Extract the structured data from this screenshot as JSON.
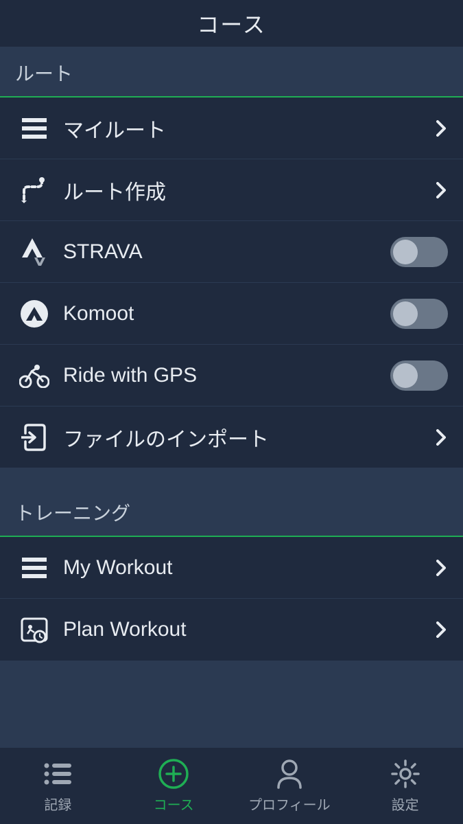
{
  "header": {
    "title": "コース"
  },
  "sections": {
    "routes": {
      "title": "ルート",
      "items": {
        "my_routes": "マイルート",
        "create_route": "ルート作成",
        "strava": "STRAVA",
        "komoot": "Komoot",
        "ride_with_gps": "Ride with GPS",
        "import_file": "ファイルのインポート"
      }
    },
    "training": {
      "title": "トレーニング",
      "items": {
        "my_workout": "My Workout",
        "plan_workout": "Plan Workout"
      }
    }
  },
  "toggles": {
    "strava": false,
    "komoot": false,
    "ride_with_gps": false
  },
  "tabbar": {
    "record": "記録",
    "course": "コース",
    "profile": "プロフィール",
    "settings": "設定",
    "active": "course"
  },
  "colors": {
    "accent": "#1fae54",
    "bg_dark": "#1f2a3e",
    "bg_mid": "#2b3a52"
  }
}
